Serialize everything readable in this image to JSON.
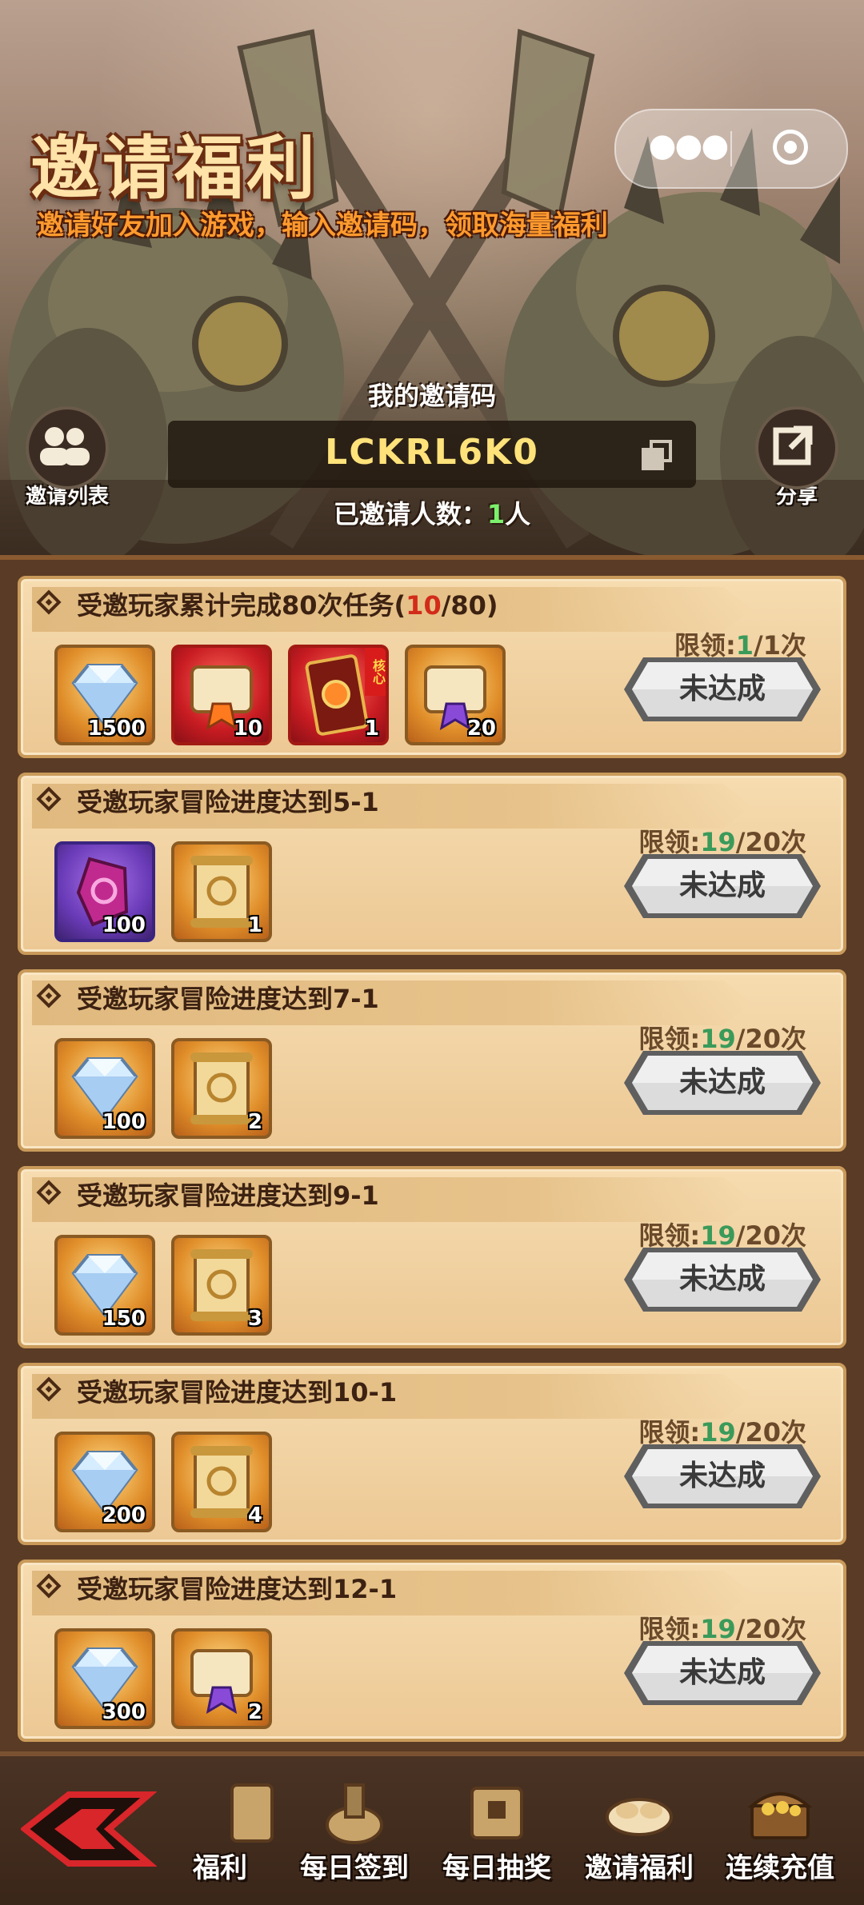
{
  "header": {
    "title": "邀请福利",
    "subtitle": "邀请好友加入游戏，输入邀请码，领取海量福利",
    "code_label": "我的邀请码",
    "invite_code": "LCKRL6K0",
    "invited_prefix": "已邀请人数：",
    "invited_count": "1",
    "invited_suffix": "人",
    "left_button": "邀请列表",
    "right_button": "分享"
  },
  "tasks": [
    {
      "title": "受邀玩家累计完成80次任务(",
      "progress_current": "10",
      "progress_total": "/80)",
      "limit_prefix": "限领:",
      "limit_current": "1",
      "limit_suffix": "/1次",
      "button": "未达成",
      "rewards": [
        {
          "icon": "diamond-icon",
          "qty": "1500"
        },
        {
          "icon": "red-scroll-icon",
          "qty": "10"
        },
        {
          "icon": "red-card-icon",
          "qty": "1",
          "tag": "核心"
        },
        {
          "icon": "purple-scroll-icon",
          "qty": "20"
        }
      ]
    },
    {
      "title": "受邀玩家冒险进度达到5-1",
      "limit_prefix": "限领:",
      "limit_current": "19",
      "limit_suffix": "/20次",
      "button": "未达成",
      "rewards": [
        {
          "icon": "purple-gem-icon",
          "qty": "100"
        },
        {
          "icon": "gold-scroll-icon",
          "qty": "1"
        }
      ]
    },
    {
      "title": "受邀玩家冒险进度达到7-1",
      "limit_prefix": "限领:",
      "limit_current": "19",
      "limit_suffix": "/20次",
      "button": "未达成",
      "rewards": [
        {
          "icon": "diamond-icon",
          "qty": "100"
        },
        {
          "icon": "gold-scroll-icon",
          "qty": "2"
        }
      ]
    },
    {
      "title": "受邀玩家冒险进度达到9-1",
      "limit_prefix": "限领:",
      "limit_current": "19",
      "limit_suffix": "/20次",
      "button": "未达成",
      "rewards": [
        {
          "icon": "diamond-icon",
          "qty": "150"
        },
        {
          "icon": "gold-scroll-icon",
          "qty": "3"
        }
      ]
    },
    {
      "title": "受邀玩家冒险进度达到10-1",
      "limit_prefix": "限领:",
      "limit_current": "19",
      "limit_suffix": "/20次",
      "button": "未达成",
      "rewards": [
        {
          "icon": "diamond-icon",
          "qty": "200"
        },
        {
          "icon": "gold-scroll-icon",
          "qty": "4"
        }
      ]
    },
    {
      "title": "受邀玩家冒险进度达到12-1",
      "limit_prefix": "限领:",
      "limit_current": "19",
      "limit_suffix": "/20次",
      "button": "未达成",
      "rewards": [
        {
          "icon": "diamond-icon",
          "qty": "300"
        },
        {
          "icon": "purple-scroll-icon",
          "qty": "2"
        }
      ]
    }
  ],
  "nav": {
    "tabs": [
      "福利",
      "每日签到",
      "每日抽奖",
      "邀请福利",
      "连续充值"
    ]
  },
  "colors": {
    "accent_orange": "#ff9a2e",
    "progress_red": "#d22b1a",
    "limit_green": "#3a9a5a",
    "invited_green": "#7cf06c"
  }
}
